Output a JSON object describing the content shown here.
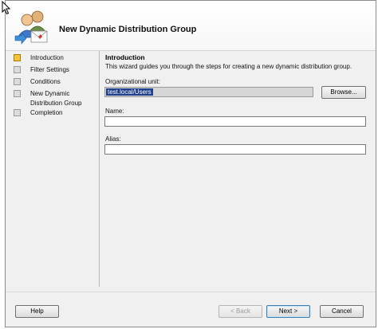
{
  "window": {
    "title": "New Dynamic Distribution Group"
  },
  "steps": [
    {
      "label": "Introduction",
      "current": true
    },
    {
      "label": "Filter Settings",
      "current": false
    },
    {
      "label": "Conditions",
      "current": false
    },
    {
      "label": "New Dynamic Distribution Group",
      "current": false
    },
    {
      "label": "Completion",
      "current": false
    }
  ],
  "intro": {
    "heading": "Introduction",
    "description": "This wizard guides you through the steps for creating a new dynamic distribution group."
  },
  "form": {
    "ou_label": "Organizational unit:",
    "ou_value": "test.local/Users",
    "browse_label": "Browse...",
    "name_label": "Name:",
    "name_value": "",
    "alias_label": "Alias:",
    "alias_value": ""
  },
  "footer": {
    "help_label": "Help",
    "back_label": "< Back",
    "next_label": "Next >",
    "cancel_label": "Cancel"
  },
  "colors": {
    "current_step": "#f7c23a",
    "selection": "#1f3f8a"
  }
}
